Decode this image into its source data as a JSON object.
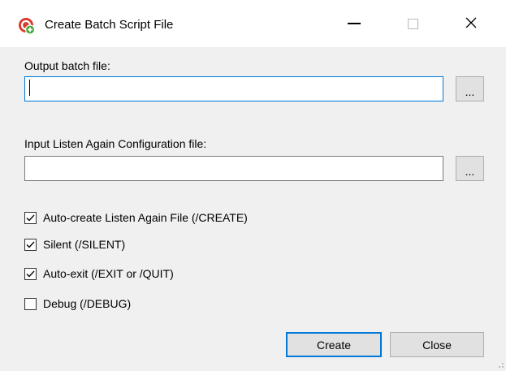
{
  "window": {
    "title": "Create Batch Script File",
    "icon": "app-logo-icon",
    "controls": {
      "minimize": "minimize-icon",
      "maximize": "maximize-icon",
      "close_glyph": "✕"
    }
  },
  "output": {
    "label": "Output batch file:",
    "value": "",
    "browse_label": "..."
  },
  "input": {
    "label": "Input Listen Again Configuration file:",
    "value": "",
    "browse_label": "..."
  },
  "options": [
    {
      "label": "Auto-create Listen Again File (/CREATE)",
      "checked": true
    },
    {
      "label": "Silent (/SILENT)",
      "checked": true
    },
    {
      "label": "Auto-exit (/EXIT or /QUIT)",
      "checked": true
    },
    {
      "label": "Debug (/DEBUG)",
      "checked": false
    }
  ],
  "buttons": {
    "create_label": "Create",
    "close_label": "Close"
  },
  "colors": {
    "accent": "#0078d7",
    "window_bg": "#f0f0f0",
    "titlebar_bg": "#ffffff",
    "icon_red": "#d83b2b",
    "icon_green": "#3fa535"
  }
}
